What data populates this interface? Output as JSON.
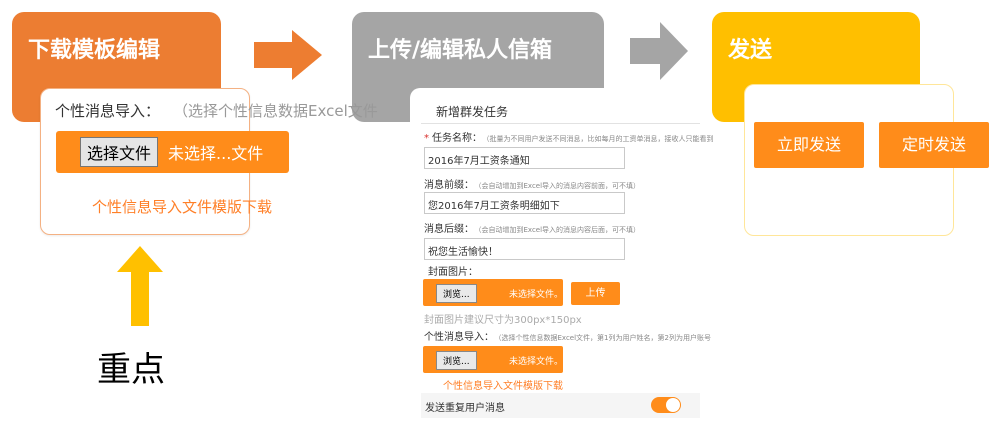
{
  "steps": [
    {
      "title": "下载模板编辑",
      "color": "#ec7d32"
    },
    {
      "title": "上传/编辑私人信箱",
      "color": "#a5a5a5"
    },
    {
      "title": "发送",
      "color": "#ffbf00"
    }
  ],
  "panel1": {
    "label": "个性消息导入：",
    "hint": "（选择个性信息数据Excel文件",
    "choose_button": "选择文件",
    "no_file": "未选择...文件",
    "template_link": "个性信息导入文件模版下载"
  },
  "annotation": {
    "text": "重点"
  },
  "form": {
    "title": "新增群发任务",
    "task_name": {
      "label": "任务名称：",
      "tip": "（批量为不同用户发送不同消息，比如每月的工资单消息，接收人只能看到",
      "value": "2016年7月工资条通知"
    },
    "prefix": {
      "label": "消息前缀：",
      "tip": "（会自动增加到Excel导入的消息内容前面，可不填）",
      "value": "您2016年7月工资条明细如下"
    },
    "suffix": {
      "label": "消息后缀：",
      "tip": "（会自动增加到Excel导入的消息内容后面，可不填）",
      "value": "祝您生活愉快！"
    },
    "cover": {
      "label": "封面图片：",
      "browse": "浏览...",
      "no_file": "未选择文件。",
      "upload": "上传",
      "size_hint": "封面图片建议尺寸为300px*150px"
    },
    "import": {
      "label": "个性消息导入：",
      "tip": "（选择个性信息数据Excel文件，第1列为用户姓名，第2列为用户账号",
      "browse": "浏览...",
      "no_file": "未选择文件。",
      "template_link": "个性信息导入文件模版下载"
    },
    "resend": {
      "label": "发送重复用户消息",
      "enabled": true
    }
  },
  "panel3": {
    "send_now": "立即发送",
    "send_timed": "定时发送"
  },
  "colors": {
    "accent_orange": "#ff8c1a",
    "arrow_orange": "#ed7d31",
    "arrow_gray": "#a5a5a5",
    "arrow_yellow": "#ffc000"
  }
}
